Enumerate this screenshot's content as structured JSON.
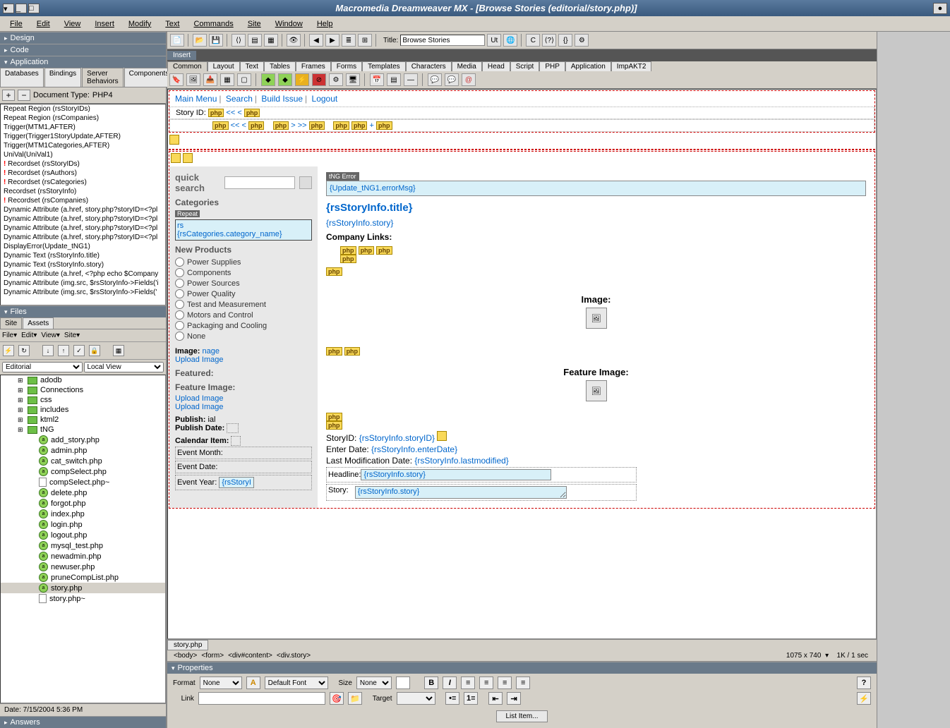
{
  "titlebar": {
    "title": "Macromedia Dreamweaver MX - [Browse Stories (editorial/story.php)]"
  },
  "menubar": [
    "File",
    "Edit",
    "View",
    "Insert",
    "Modify",
    "Text",
    "Commands",
    "Site",
    "Window",
    "Help"
  ],
  "left": {
    "panels": [
      "Design",
      "Code",
      "Application"
    ],
    "app_tabs": [
      "Databases",
      "Bindings",
      "Server Behaviors",
      "Components"
    ],
    "doc_type_label": "Document Type:",
    "doc_type": "PHP4",
    "behaviors": [
      {
        "t": "Repeat Region (rsStoryIDs)"
      },
      {
        "t": "Repeat Region (rsCompanies)"
      },
      {
        "t": "Trigger(MTM1,AFTER)"
      },
      {
        "t": "Trigger(Trigger1StoryUpdate,AFTER)"
      },
      {
        "t": "Trigger(MTM1Categories,AFTER)"
      },
      {
        "t": "UniVal(UniVal1)"
      },
      {
        "t": "Recordset (rsStoryIDs)",
        "e": 1
      },
      {
        "t": "Recordset (rsAuthors)",
        "e": 1
      },
      {
        "t": "Recordset (rsCategories)",
        "e": 1
      },
      {
        "t": "Recordset (rsStoryInfo)"
      },
      {
        "t": "Recordset (rsCompanies)",
        "e": 1
      },
      {
        "t": "Dynamic Attribute (a.href, story.php?storyID=<?pl"
      },
      {
        "t": "Dynamic Attribute (a.href, story.php?storyID=<?pl"
      },
      {
        "t": "Dynamic Attribute (a.href, story.php?storyID=<?pl"
      },
      {
        "t": "Dynamic Attribute (a.href, story.php?storyID=<?pl"
      },
      {
        "t": "DisplayError(Update_tNG1)"
      },
      {
        "t": "Dynamic Text (rsStoryInfo.title)"
      },
      {
        "t": "Dynamic Text (rsStoryInfo.story)"
      },
      {
        "t": "Dynamic Attribute (a.href, <?php echo $Company"
      },
      {
        "t": "Dynamic Attribute (img.src, $rsStoryInfo->Fields('i"
      },
      {
        "t": "Dynamic Attribute (img.src, $rsStoryInfo->Fields('"
      }
    ],
    "files_panel": "Files",
    "files_tabs": [
      "Site",
      "Assets"
    ],
    "files_menu": [
      "File▾",
      "Edit▾",
      "View▾",
      "Site▾"
    ],
    "site_sel": "Editorial",
    "view_sel": "Local View",
    "tree": [
      {
        "i": 1,
        "k": "fld",
        "exp": "⊞",
        "n": "adodb"
      },
      {
        "i": 1,
        "k": "fld",
        "exp": "⊞",
        "n": "Connections"
      },
      {
        "i": 1,
        "k": "fld",
        "exp": "⊞",
        "n": "css"
      },
      {
        "i": 1,
        "k": "fld",
        "exp": "⊞",
        "n": "includes"
      },
      {
        "i": 1,
        "k": "fld",
        "exp": "⊞",
        "n": "ktml2"
      },
      {
        "i": 1,
        "k": "fld",
        "exp": "⊞",
        "n": "tNG"
      },
      {
        "i": 2,
        "k": "php",
        "n": "add_story.php"
      },
      {
        "i": 2,
        "k": "php",
        "n": "admin.php"
      },
      {
        "i": 2,
        "k": "php",
        "n": "cat_switch.php"
      },
      {
        "i": 2,
        "k": "php",
        "n": "compSelect.php"
      },
      {
        "i": 2,
        "k": "f",
        "n": "compSelect.php~"
      },
      {
        "i": 2,
        "k": "php",
        "n": "delete.php"
      },
      {
        "i": 2,
        "k": "php",
        "n": "forgot.php"
      },
      {
        "i": 2,
        "k": "php",
        "n": "index.php"
      },
      {
        "i": 2,
        "k": "php",
        "n": "login.php"
      },
      {
        "i": 2,
        "k": "php",
        "n": "logout.php"
      },
      {
        "i": 2,
        "k": "php",
        "n": "mysql_test.php"
      },
      {
        "i": 2,
        "k": "php",
        "n": "newadmin.php"
      },
      {
        "i": 2,
        "k": "php",
        "n": "newuser.php"
      },
      {
        "i": 2,
        "k": "php",
        "n": "pruneCompList.php"
      },
      {
        "i": 2,
        "k": "php",
        "n": "story.php",
        "sel": 1
      },
      {
        "i": 2,
        "k": "f",
        "n": "story.php~"
      }
    ],
    "status": "Date: 7/15/2004 5:36 PM",
    "answers": "Answers"
  },
  "doc": {
    "title_label": "Title:",
    "title_value": "Browse Stories",
    "insert": "Insert",
    "insert_cats": [
      "Common",
      "Layout",
      "Text",
      "Tables",
      "Frames",
      "Forms",
      "Templates",
      "Characters",
      "Media",
      "Head",
      "Script",
      "PHP",
      "Application",
      "ImpAKT2"
    ],
    "nav": [
      "Main Menu",
      "Search",
      "Build Issue",
      "Logout"
    ],
    "story_id_label": "Story ID:",
    "qs_label": "quick search",
    "cat_label": "Categories",
    "repeat": "Repeat",
    "cat_rs": "rs",
    "cat_val": "{rsCategories.category_name}",
    "np_label": "New Products",
    "np": [
      "Power Supplies",
      "Components",
      "Power Sources",
      "Power Quality",
      "Test and Measurement",
      "Motors and Control",
      "Packaging and Cooling",
      "None"
    ],
    "image_lbl": "Image:",
    "image_val": "nage",
    "upload": "Upload Image",
    "featured": "Featured:",
    "feat_img": "Feature Image:",
    "publish": "Publish:",
    "publish_val": "ial",
    "pub_date": "Publish Date:",
    "cal": "Calendar Item:",
    "ev_month": "Event Month:",
    "ev_date": "Event Date:",
    "ev_year": "Event Year:",
    "ev_year_val": "{rsStoryIr",
    "tng_lbl": "tNG Error",
    "tng_err": "{Update_tNG1.errorMsg}",
    "st_title": "{rsStoryInfo.title}",
    "st_story": "{rsStoryInfo.story}",
    "comp_links": "Company Links:",
    "img_lbl2": "Image:",
    "feat_lbl2": "Feature Image:",
    "m_storyid": "StoryID:",
    "m_storyid_v": "{rsStoryInfo.storyID}",
    "m_enter": "Enter Date:",
    "m_enter_v": "{rsStoryInfo.enterDate}",
    "m_mod": "Last Modification Date:",
    "m_mod_v": "{rsStoryInfo.lastmodified}",
    "headline": "Headline:",
    "headline_v": "{rsStoryInfo.story}",
    "story_lbl": "Story:",
    "story_v": "{rsStoryInfo.story}",
    "tab": "story.php",
    "path": [
      "<body>",
      "<form>",
      "<div#content>",
      "<div.story>"
    ],
    "dims": "1075 x 740",
    "size": "1K / 1 sec"
  },
  "props": {
    "title": "Properties",
    "format": "Format",
    "format_v": "None",
    "font": "Default Font",
    "size": "Size",
    "size_v": "None",
    "link": "Link",
    "target": "Target",
    "list_item": "List Item..."
  }
}
